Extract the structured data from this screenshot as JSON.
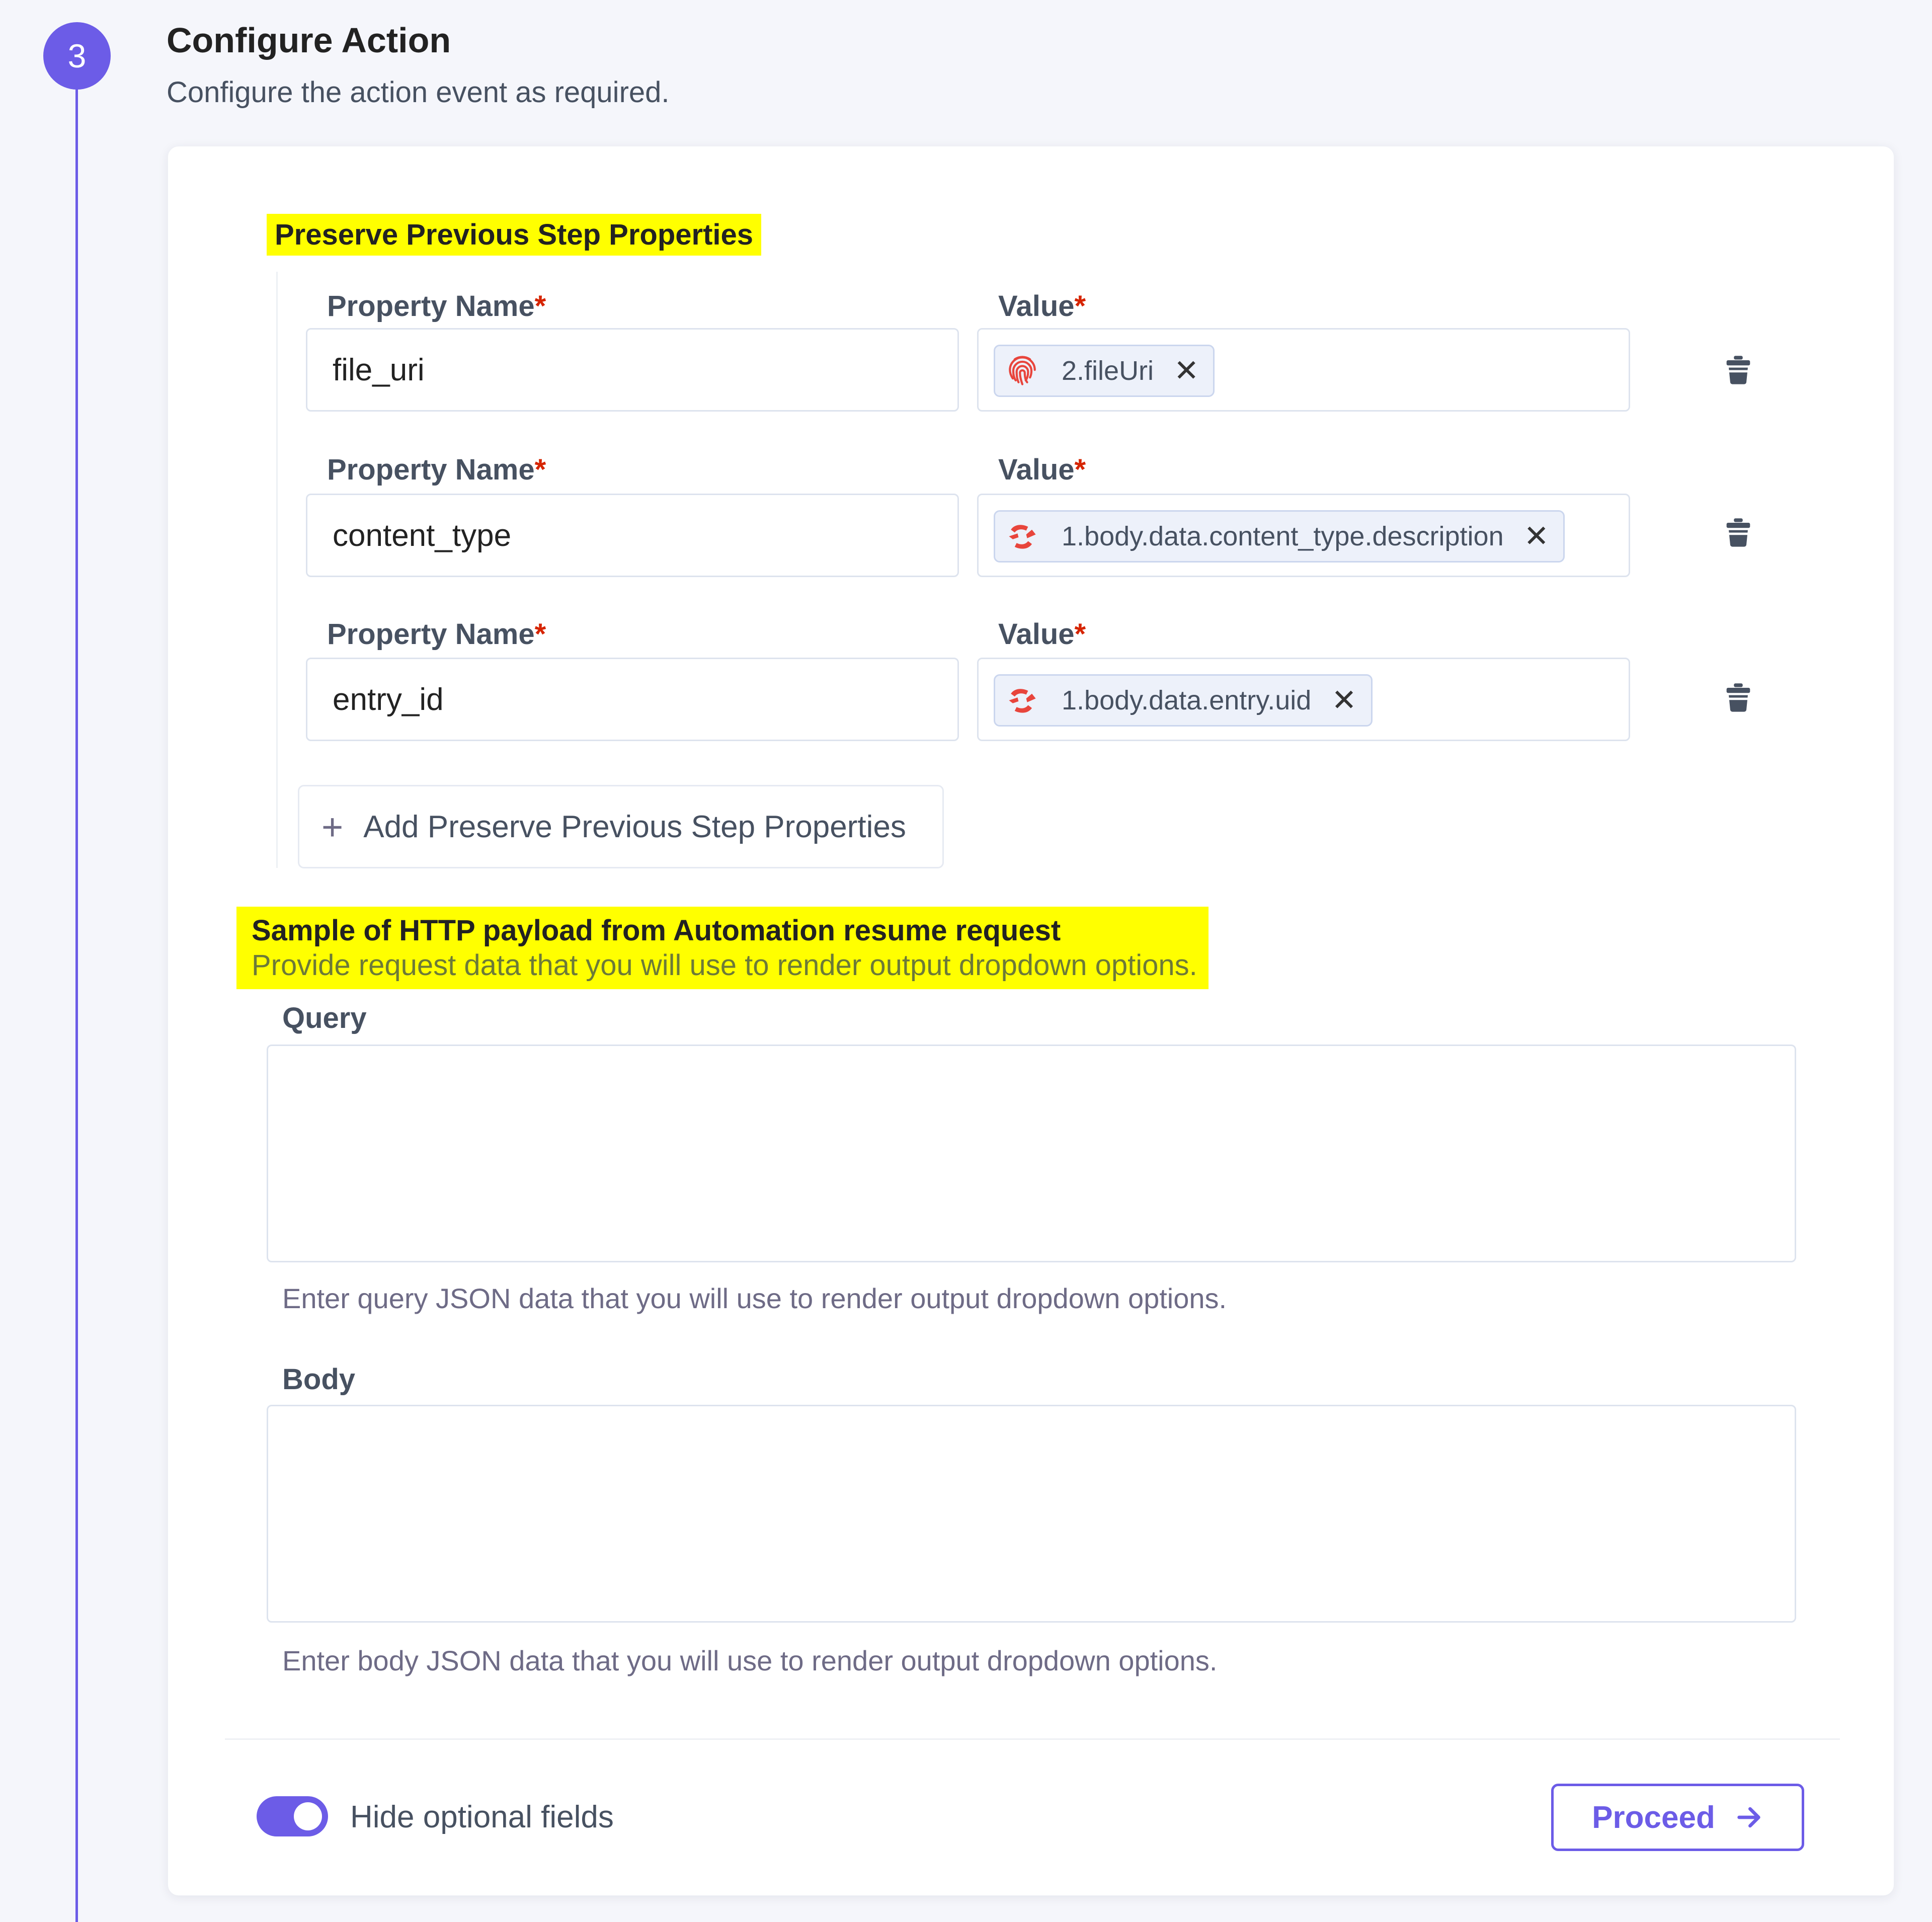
{
  "step": {
    "number": "3",
    "title": "Configure Action",
    "subtitle": "Configure the action event as required."
  },
  "preserve": {
    "title": "Preserve Previous Step Properties",
    "name_label": "Property Name",
    "value_label": "Value",
    "required_mark": "*",
    "rows": [
      {
        "name": "file_uri",
        "value": "2.fileUri",
        "value_icon": "fingerprint-icon"
      },
      {
        "name": "content_type",
        "value": "1.body.data.content_type.description",
        "value_icon": "contentstack-logo-icon"
      },
      {
        "name": "entry_id",
        "value": "1.body.data.entry.uid",
        "value_icon": "contentstack-logo-icon"
      }
    ],
    "chip_close": "✕",
    "add_label": "Add Preserve Previous Step Properties",
    "add_icon": "+"
  },
  "payload": {
    "title": "Sample of HTTP payload from Automation resume request",
    "description": "Provide request data that you will use to render output dropdown options.",
    "query_label": "Query",
    "query_value": "",
    "query_help": "Enter query JSON data that you will use to render output dropdown options.",
    "body_label": "Body",
    "body_value": "",
    "body_help": "Enter body JSON data that you will use to render output dropdown options."
  },
  "footer": {
    "toggle_label": "Hide optional fields",
    "toggle_on": true,
    "proceed_label": "Proceed"
  },
  "colors": {
    "accent": "#6c5ce7",
    "highlight": "#ffff00",
    "required": "#d62400",
    "chip_icon": "#e8453c"
  }
}
